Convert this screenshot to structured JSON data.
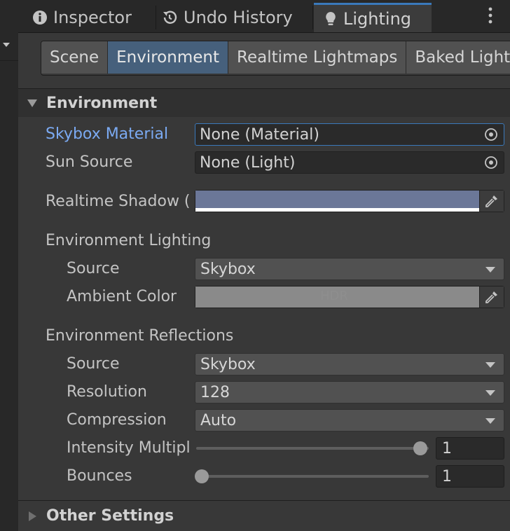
{
  "tabs": [
    {
      "label": "Inspector",
      "icon": "info-icon"
    },
    {
      "label": "Undo History",
      "icon": "history-icon"
    },
    {
      "label": "Lighting",
      "icon": "lightbulb-icon"
    }
  ],
  "subtabs": [
    "Scene",
    "Environment",
    "Realtime Lightmaps",
    "Baked Lightm"
  ],
  "section": {
    "title": "Environment",
    "skybox": {
      "label": "Skybox Material",
      "value": "None (Material)"
    },
    "sun": {
      "label": "Sun Source",
      "value": "None (Light)"
    },
    "shadow": {
      "label": "Realtime Shadow (",
      "color": "#6b7798"
    },
    "env_lighting": {
      "title": "Environment Lighting",
      "source_label": "Source",
      "source_value": "Skybox",
      "ambient_label": "Ambient Color",
      "ambient_color": "#8a8a8a",
      "ambient_badge": "HDR"
    },
    "env_reflections": {
      "title": "Environment Reflections",
      "source_label": "Source",
      "source_value": "Skybox",
      "resolution_label": "Resolution",
      "resolution_value": "128",
      "compression_label": "Compression",
      "compression_value": "Auto",
      "intensity_label": "Intensity Multipl",
      "intensity_value": "1",
      "intensity_fraction": 1.0,
      "bounces_label": "Bounces",
      "bounces_value": "1",
      "bounces_fraction": 0.0
    }
  },
  "other_settings": {
    "title": "Other Settings"
  },
  "colors": {
    "accent": "#3a79bb",
    "focus_label": "#7baaf2",
    "active_subtab": "#46607c"
  }
}
